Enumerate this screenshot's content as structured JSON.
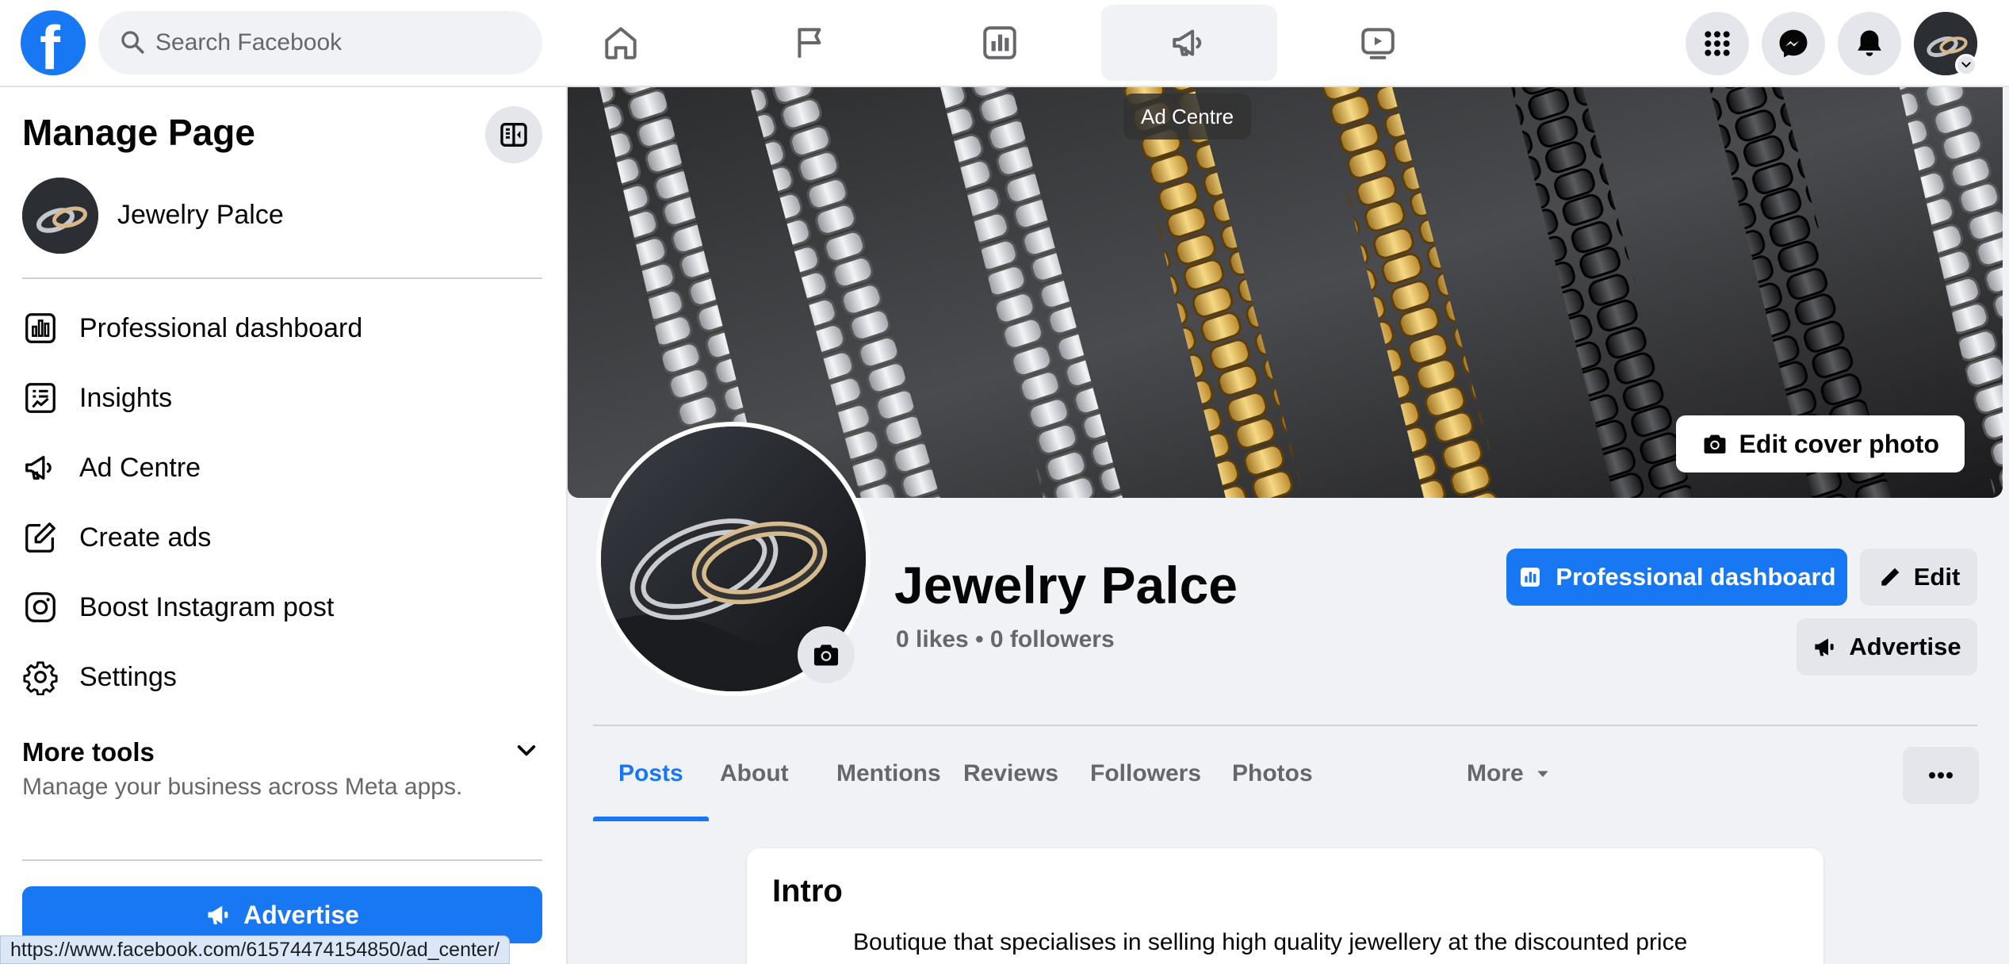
{
  "topbar": {
    "logo_letter": "f",
    "search_placeholder": "Search Facebook",
    "nav": [
      "home-icon",
      "flag-icon",
      "dashboard-icon",
      "megaphone-icon",
      "video-icon"
    ],
    "active_nav_tooltip": "Ad Centre",
    "right_icons": [
      "grid-menu-icon",
      "messenger-icon",
      "bell-icon"
    ]
  },
  "left_panel": {
    "title": "Manage Page",
    "page_name": "Jewelry Palce",
    "menu": [
      {
        "label": "Professional dashboard",
        "icon": "dashboard-icon"
      },
      {
        "label": "Insights",
        "icon": "insights-icon"
      },
      {
        "label": "Ad Centre",
        "icon": "megaphone-icon"
      },
      {
        "label": "Create ads",
        "icon": "pencil-square-icon"
      },
      {
        "label": "Boost Instagram post",
        "icon": "instagram-icon"
      },
      {
        "label": "Settings",
        "icon": "gear-icon"
      }
    ],
    "more_tools": {
      "title": "More tools",
      "subtitle": "Manage your business across Meta apps."
    },
    "advertise_label": "Advertise"
  },
  "status_url": "https://www.facebook.com/61574474154850/ad_center/",
  "cover": {
    "edit_label": "Edit cover photo"
  },
  "profile": {
    "name": "Jewelry Palce",
    "stats": "0 likes • 0 followers",
    "buttons": {
      "dashboard": "Professional dashboard",
      "edit": "Edit",
      "advertise": "Advertise"
    }
  },
  "tabs": {
    "items": [
      "Posts",
      "About",
      "Mentions",
      "Reviews",
      "Followers",
      "Photos",
      "More"
    ],
    "active": "Posts"
  },
  "intro": {
    "title": "Intro",
    "text": "Boutique that specialises in selling high quality jewellery at the discounted price"
  },
  "colors": {
    "brand": "#1877f2",
    "text": "#050505",
    "secondary_text": "#65676b",
    "background": "#f0f2f5"
  }
}
